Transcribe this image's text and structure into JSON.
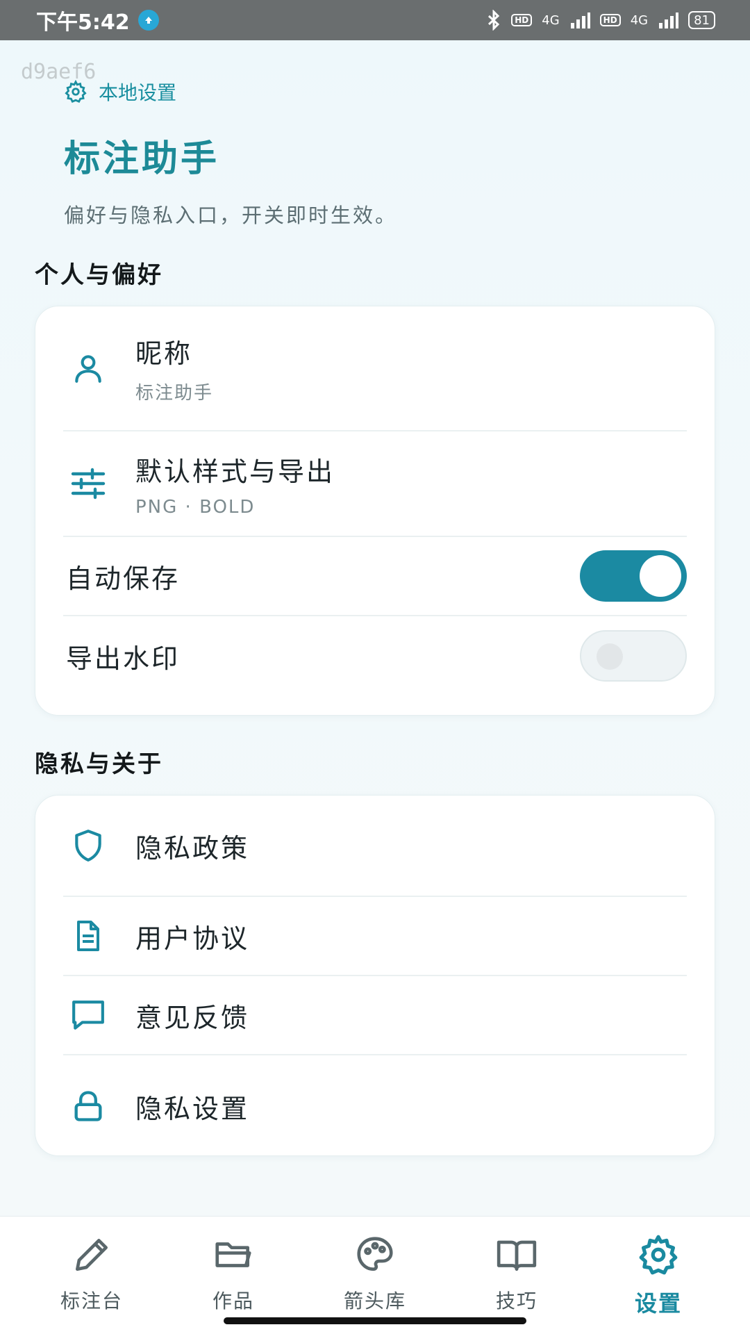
{
  "status_bar": {
    "time": "下午5:42",
    "network_1": "4G",
    "network_2": "4G",
    "hd_label": "HD",
    "battery": "81"
  },
  "watermark": "d9aef6",
  "header": {
    "tag": "本地设置",
    "title": "标注助手",
    "subtitle": "偏好与隐私入口，开关即时生效。"
  },
  "sections": {
    "personal": {
      "title": "个人与偏好",
      "nickname": {
        "label": "昵称",
        "value": "标注助手"
      },
      "style_export": {
        "label": "默认样式与导出",
        "value": "PNG · BOLD"
      },
      "auto_save": {
        "label": "自动保存",
        "enabled": true
      },
      "export_watermark": {
        "label": "导出水印",
        "enabled": false
      }
    },
    "privacy": {
      "title": "隐私与关于",
      "items": [
        {
          "label": "隐私政策",
          "icon": "shield-icon"
        },
        {
          "label": "用户协议",
          "icon": "document-icon"
        },
        {
          "label": "意见反馈",
          "icon": "chat-icon"
        },
        {
          "label": "隐私设置",
          "icon": "lock-icon"
        }
      ]
    }
  },
  "bottom_nav": [
    {
      "label": "标注台",
      "icon": "pencil-icon",
      "active": false
    },
    {
      "label": "作品",
      "icon": "folder-icon",
      "active": false
    },
    {
      "label": "箭头库",
      "icon": "palette-icon",
      "active": false
    },
    {
      "label": "技巧",
      "icon": "book-icon",
      "active": false
    },
    {
      "label": "设置",
      "icon": "gear-icon",
      "active": true
    }
  ],
  "colors": {
    "accent": "#1b8aa2",
    "title": "#1d8a97",
    "status_bar": "#6a6e6f"
  }
}
